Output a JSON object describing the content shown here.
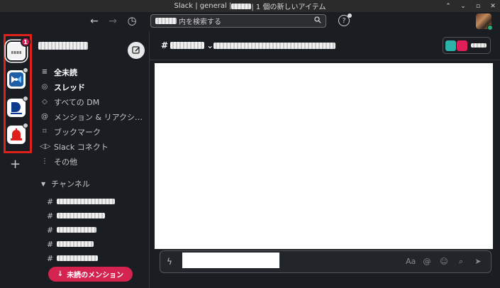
{
  "titlebar": {
    "prefix": "Slack | general | ",
    "suffix": " | 1 個の新しいアイテム",
    "controls": [
      "chevron-up-icon",
      "chevron-down-icon",
      "maximize-icon",
      "close-icon"
    ]
  },
  "toolbar": {
    "back_icon": "←",
    "forward_icon": "→",
    "history_icon": "◷",
    "search_placeholder": "内を検索する",
    "help_icon": "?"
  },
  "rail": {
    "badge_count": "1",
    "add_label": "+"
  },
  "sidebar": {
    "nav": [
      {
        "icon": "≡",
        "label": "全未読",
        "bold": true
      },
      {
        "icon": "◎",
        "label": "スレッド",
        "bold": true
      },
      {
        "icon": "◇",
        "label": "すべての DM",
        "bold": false
      },
      {
        "icon": "@",
        "label": "メンション & リアクシ…",
        "bold": false
      },
      {
        "icon": "⌑",
        "label": "ブックマーク",
        "bold": false
      },
      {
        "icon": "◁▷",
        "label": "Slack コネクト",
        "bold": false
      },
      {
        "icon": "⋮",
        "label": "その他",
        "bold": false
      }
    ],
    "section_label": "チャンネル",
    "channels": [
      "#",
      "#",
      "#",
      "#",
      "#"
    ],
    "unread_pill": "未読のメンション",
    "unread_arrow": "↓"
  },
  "channel": {
    "hash": "#",
    "chevron": "⌄"
  },
  "composer": {
    "bolt_icon": "ϟ",
    "tools": [
      "Aa",
      "@",
      "☺",
      "⌕",
      "➤"
    ]
  },
  "colors": {
    "badge": "#e01e5a",
    "highlight_box": "#e0201a",
    "unread_pill": "#d4234f",
    "online": "#2bac76"
  }
}
